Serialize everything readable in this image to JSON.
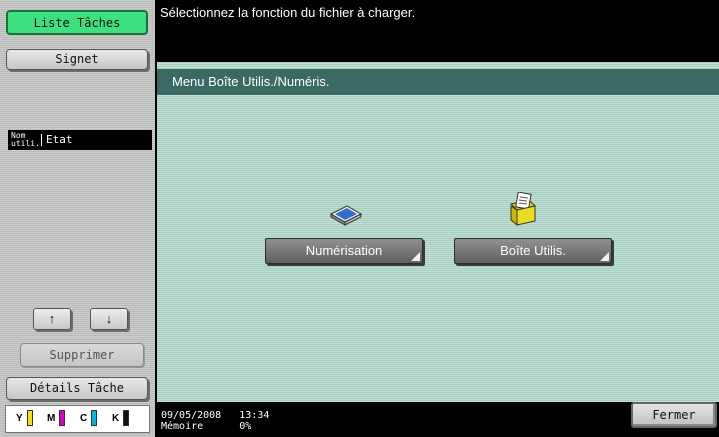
{
  "left_panel": {
    "liste_taches": "Liste Tâches",
    "signet": "Signet",
    "status_header": {
      "col_user": "Nom utili.",
      "col_state": "Etat"
    },
    "up_arrow": "↑",
    "down_arrow": "↓",
    "supprimer": "Supprimer",
    "details_tache": "Détails Tâche",
    "toner": [
      {
        "label": "Y",
        "color": "#f2e600"
      },
      {
        "label": "M",
        "color": "#d400c8"
      },
      {
        "label": "C",
        "color": "#00b6e6"
      },
      {
        "label": "K",
        "color": "#111111"
      }
    ]
  },
  "instruction": "Sélectionnez la fonction du fichier à charger.",
  "main": {
    "header": "Menu Boîte Utilis./Numéris.",
    "scan_button": "Numérisation",
    "box_button": "Boîte Utilis.",
    "scan_icon": "scanner-icon",
    "box_icon": "user-box-icon"
  },
  "footer": {
    "date": "09/05/2008",
    "time": "13:34",
    "memory_label": "Mémoire",
    "memory_value": "0%",
    "fermer": "Fermer"
  }
}
